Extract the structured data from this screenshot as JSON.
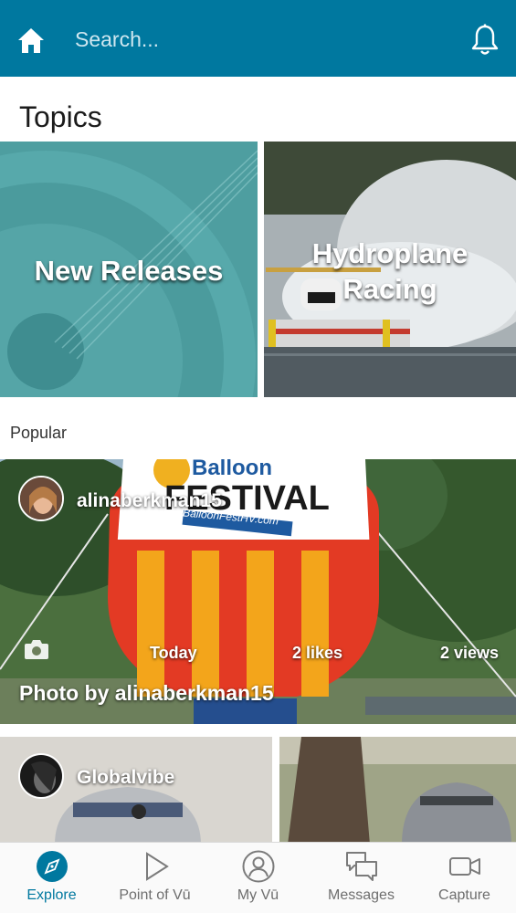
{
  "header": {
    "search_placeholder": "Search...",
    "home_icon": "home-icon",
    "bell_icon": "bell-icon",
    "color": "#00789f"
  },
  "topics": {
    "title": "Topics",
    "tiles": [
      {
        "title": "New Releases"
      },
      {
        "title_line1": "Hydroplane",
        "title_line2": "Racing"
      }
    ]
  },
  "popular": {
    "label": "Popular",
    "cards": [
      {
        "username": "alinaberkman15",
        "time": "Today",
        "likes": "2 likes",
        "views": "2 views",
        "caption": "Photo by alinaberkman15",
        "balloon_text": "Balloon",
        "balloon_text2": "FESTIVAL",
        "balloon_url": "BalloonFestHV.com"
      },
      {
        "username": "Globalvibe"
      }
    ]
  },
  "bottom_nav": {
    "items": [
      {
        "label": "Explore",
        "icon": "explore-icon",
        "active": true
      },
      {
        "label": "Point of Vū",
        "icon": "play-icon"
      },
      {
        "label": "My Vū",
        "icon": "profile-icon"
      },
      {
        "label": "Messages",
        "icon": "messages-icon"
      },
      {
        "label": "Capture",
        "icon": "video-camera-icon"
      }
    ]
  }
}
